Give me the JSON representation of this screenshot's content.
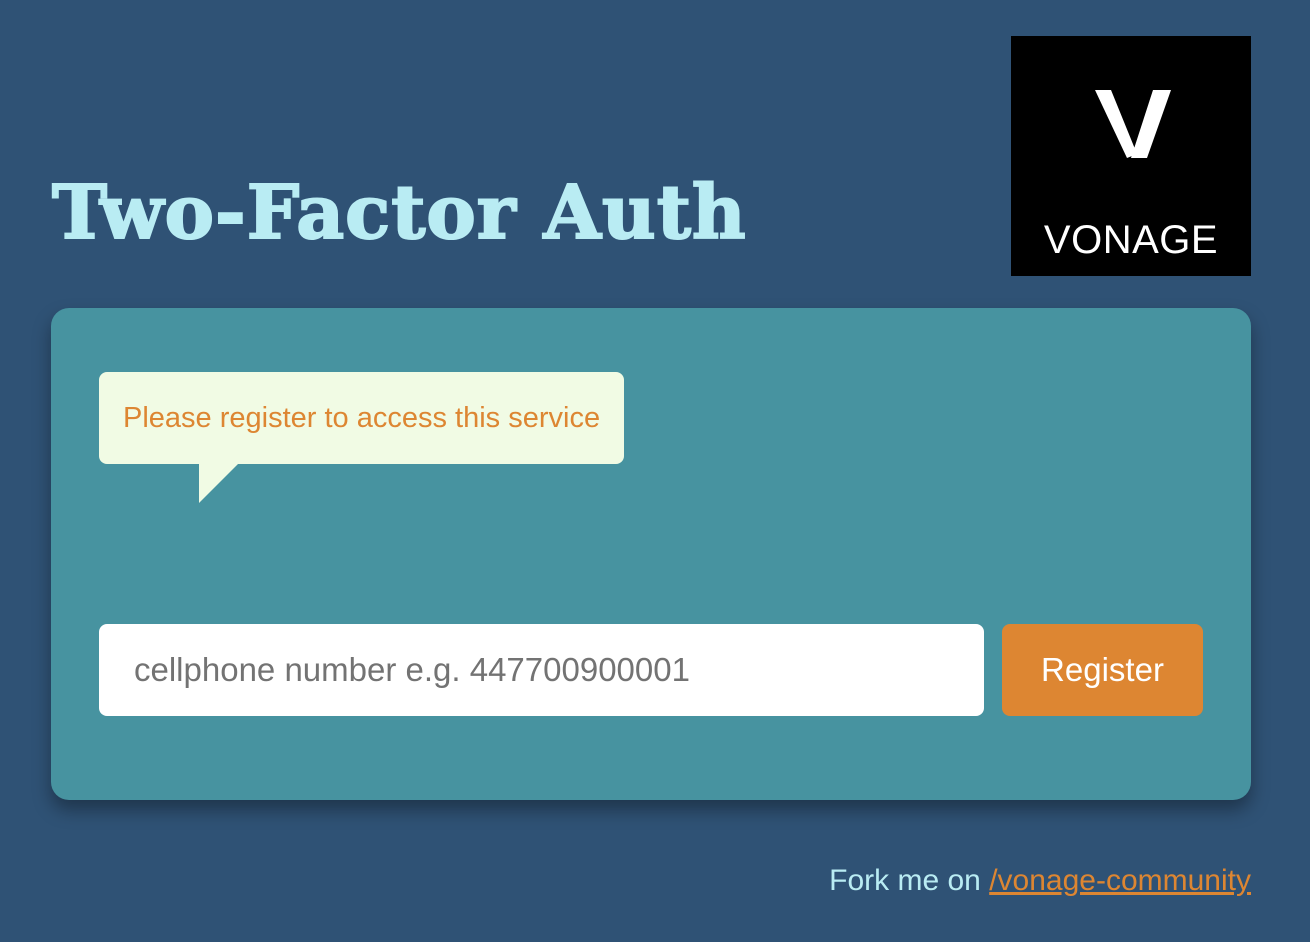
{
  "header": {
    "title": "Two-Factor Auth"
  },
  "logo": {
    "brand_text": "VONAGE",
    "icon": "vonage-v-icon"
  },
  "card": {
    "message": "Please register to access this service",
    "phone_input": {
      "value": "",
      "placeholder": "cellphone number e.g. 447700900001"
    },
    "register_label": "Register"
  },
  "footer": {
    "prefix": "Fork me on ",
    "link_text": "/vonage-community"
  },
  "colors": {
    "background": "#2f5275",
    "card": "#4793a0",
    "accent": "#dd8632",
    "title": "#b9ecf3",
    "bubble": "#f1fbe4"
  }
}
